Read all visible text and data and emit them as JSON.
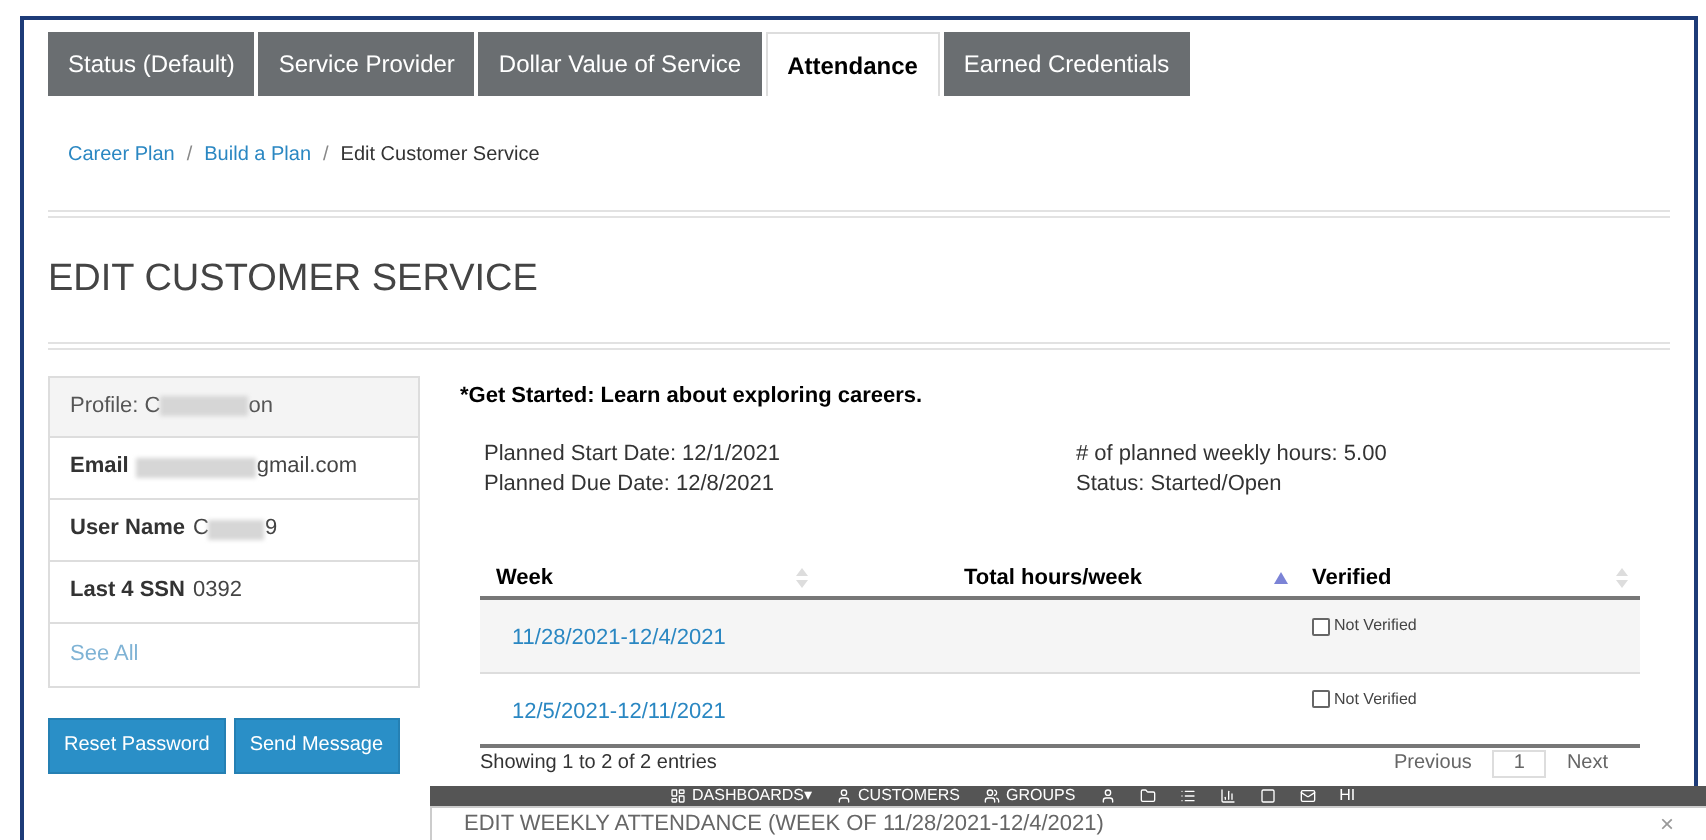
{
  "tabs": [
    {
      "label": "Status (Default)",
      "selected": false
    },
    {
      "label": "Service Provider",
      "selected": false
    },
    {
      "label": "Dollar Value of Service",
      "selected": false
    },
    {
      "label": "Attendance",
      "selected": true
    },
    {
      "label": "Earned Credentials",
      "selected": false
    }
  ],
  "breadcrumb": [
    {
      "label": "Career Plan",
      "link": true
    },
    {
      "label": "Build a Plan",
      "link": true
    },
    {
      "label": "Edit Customer Service",
      "link": false
    }
  ],
  "breadcrumb_separator": "/",
  "page_title": "EDIT CUSTOMER SERVICE",
  "profile": {
    "header_prefix": "Profile: C",
    "header_suffix": "on",
    "rows": [
      {
        "label": "Email",
        "before": "",
        "after": "gmail.com",
        "redacted": true
      },
      {
        "label": "User Name",
        "before": "C",
        "after": "9",
        "redacted": true
      },
      {
        "label": "Last 4 SSN",
        "before": "0392",
        "after": "",
        "redacted": false
      }
    ],
    "see_all": "See All"
  },
  "buttons": [
    "Reset Password",
    "Send Message"
  ],
  "service_title": "*Get Started: Learn about exploring careers.",
  "details": [
    "Planned Start Date: 12/1/2021",
    "# of planned weekly hours: 5.00",
    "Planned Due Date: 12/8/2021",
    "Status: Started/Open"
  ],
  "table": {
    "columns": [
      {
        "label": "Week",
        "sorted": false
      },
      {
        "label": "Total hours/week",
        "sorted": true
      },
      {
        "label": "Verified",
        "sorted": false
      }
    ],
    "rows": [
      {
        "week": "11/28/2021-12/4/2021",
        "verified": false,
        "verified_label": "Not Verified"
      },
      {
        "week": "12/5/2021-12/11/2021",
        "verified": false,
        "verified_label": "Not Verified"
      }
    ]
  },
  "table_info": "Showing 1 to 2 of 2 entries",
  "pagination": {
    "previous": "Previous",
    "pages": [
      {
        "label": "1",
        "selected": true
      }
    ],
    "next": "Next"
  },
  "nav_bar": [
    {
      "label": "DASHBOARDS▾",
      "kind": "dashboard"
    },
    {
      "label": "CUSTOMERS",
      "kind": "person"
    },
    {
      "label": "GROUPS",
      "kind": "group"
    },
    {
      "kind": "person"
    },
    {
      "kind": "folder"
    },
    {
      "kind": "list"
    },
    {
      "kind": "chart"
    },
    {
      "kind": "square"
    },
    {
      "kind": "mail"
    },
    {
      "label": "HI",
      "kind": "text"
    }
  ],
  "modal": {
    "title": "EDIT WEEKLY ATTENDANCE (WEEK OF 11/28/2021-12/4/2021)",
    "close": "×"
  }
}
